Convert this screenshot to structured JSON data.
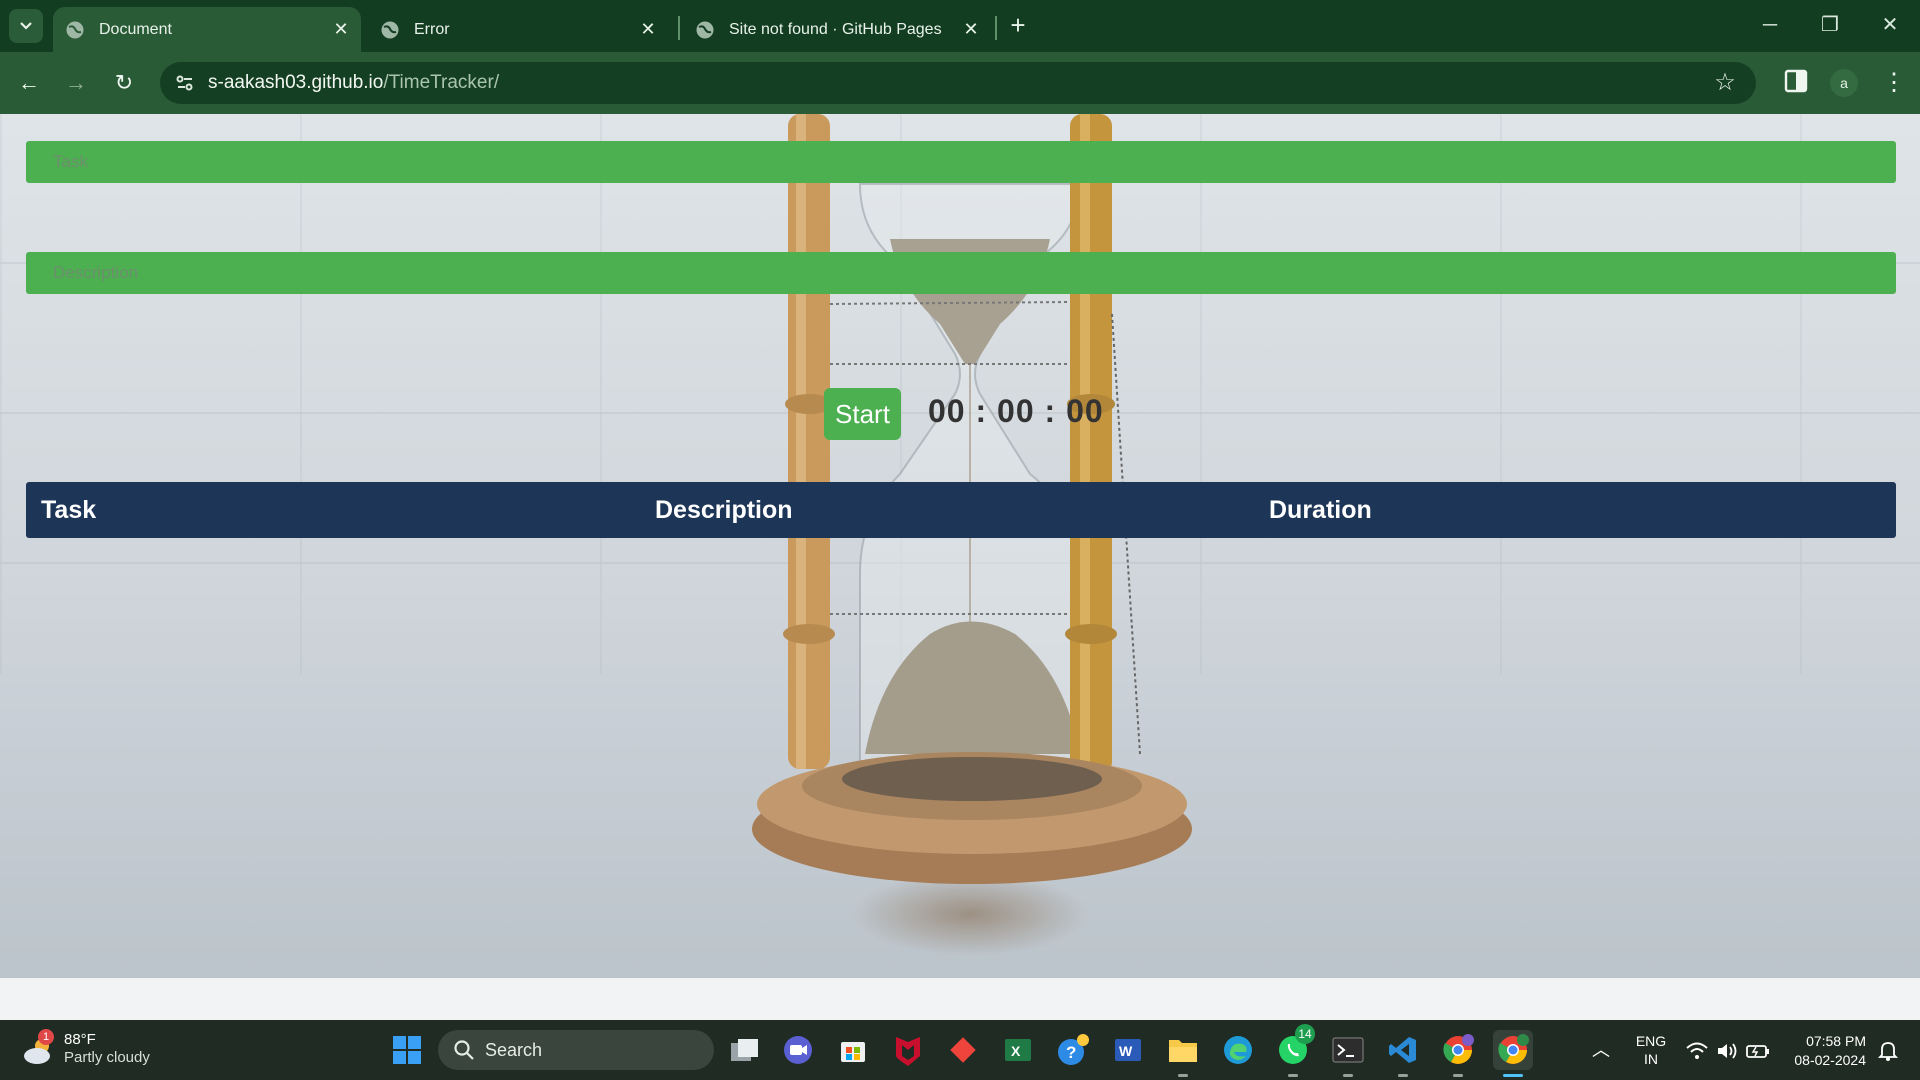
{
  "browser": {
    "tabs": [
      {
        "title": "Document",
        "active": true
      },
      {
        "title": "Error",
        "active": false
      },
      {
        "title": "Site not found · GitHub Pages",
        "active": false
      }
    ],
    "url_host": "s-aakash03.github.io",
    "url_path": "/TimeTracker/",
    "profile_initial": "a"
  },
  "page": {
    "task_placeholder": "Task",
    "description_placeholder": "Description",
    "start_label": "Start",
    "timer": {
      "hours": "00",
      "minutes": "00",
      "seconds": "00"
    },
    "table": {
      "headers": [
        "Task",
        "Description",
        "Duration"
      ]
    }
  },
  "taskbar": {
    "weather": {
      "temp": "88°F",
      "condition": "Partly cloudy",
      "badge": "1"
    },
    "search_label": "Search",
    "whatsapp_badge": "14",
    "lang": {
      "line1": "ENG",
      "line2": "IN"
    },
    "clock": {
      "time": "07:58 PM",
      "date": "08-02-2024"
    }
  },
  "colors": {
    "browser_frame": "#123d21",
    "toolbar": "#2a5b37",
    "input_green": "#4caf50",
    "table_header": "#1d3557",
    "taskbar": "#1f2b23"
  }
}
